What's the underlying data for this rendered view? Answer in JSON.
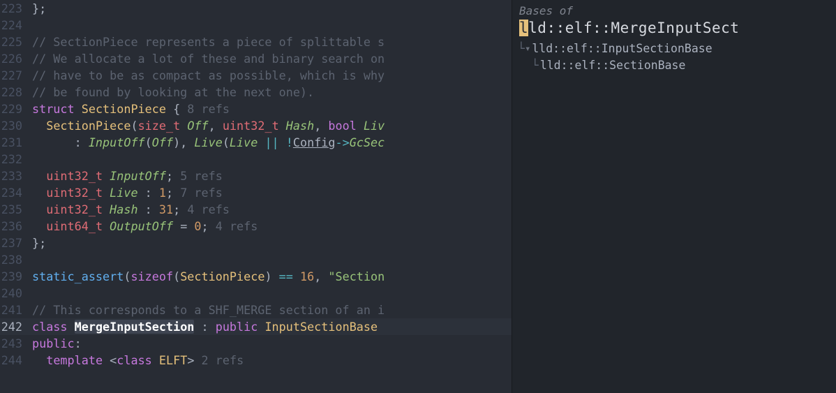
{
  "editor": {
    "lines": [
      {
        "num": "223",
        "tokens": [
          {
            "t": "};",
            "c": "punct"
          }
        ]
      },
      {
        "num": "224",
        "tokens": []
      },
      {
        "num": "225",
        "tokens": [
          {
            "t": "// SectionPiece represents a piece of splittable s",
            "c": "comment"
          }
        ]
      },
      {
        "num": "226",
        "tokens": [
          {
            "t": "// We allocate a lot of these and binary search on",
            "c": "comment"
          }
        ]
      },
      {
        "num": "227",
        "tokens": [
          {
            "t": "// have to be as compact as possible, which is why",
            "c": "comment"
          }
        ]
      },
      {
        "num": "228",
        "tokens": [
          {
            "t": "// be found by looking at the next one).",
            "c": "comment"
          }
        ]
      },
      {
        "num": "229",
        "tokens": [
          {
            "t": "struct",
            "c": "keyword"
          },
          {
            "t": " "
          },
          {
            "t": "SectionPiece",
            "c": "typename"
          },
          {
            "t": " { ",
            "c": "punct"
          },
          {
            "t": "8 refs",
            "c": "hint"
          }
        ]
      },
      {
        "num": "230",
        "tokens": [
          {
            "t": "  "
          },
          {
            "t": "SectionPiece",
            "c": "typename"
          },
          {
            "t": "(",
            "c": "punct"
          },
          {
            "t": "size_t",
            "c": "type"
          },
          {
            "t": " "
          },
          {
            "t": "Off",
            "c": "param"
          },
          {
            "t": ", ",
            "c": "punct"
          },
          {
            "t": "uint32_t",
            "c": "type"
          },
          {
            "t": " "
          },
          {
            "t": "Hash",
            "c": "param"
          },
          {
            "t": ", ",
            "c": "punct"
          },
          {
            "t": "bool",
            "c": "keyword"
          },
          {
            "t": " "
          },
          {
            "t": "Liv",
            "c": "param"
          }
        ]
      },
      {
        "num": "231",
        "tokens": [
          {
            "t": "      : ",
            "c": "punct"
          },
          {
            "t": "InputOff",
            "c": "param italic"
          },
          {
            "t": "(",
            "c": "punct"
          },
          {
            "t": "Off",
            "c": "param"
          },
          {
            "t": "), ",
            "c": "punct"
          },
          {
            "t": "Live",
            "c": "param italic"
          },
          {
            "t": "(",
            "c": "punct"
          },
          {
            "t": "Live",
            "c": "param"
          },
          {
            "t": " ",
            "c": "punct"
          },
          {
            "t": "||",
            "c": "op"
          },
          {
            "t": " ",
            "c": "punct"
          },
          {
            "t": "!",
            "c": "op"
          },
          {
            "t": "Config",
            "c": "ident underline"
          },
          {
            "t": "->",
            "c": "op"
          },
          {
            "t": "GcSec",
            "c": "param italic"
          }
        ]
      },
      {
        "num": "232",
        "tokens": []
      },
      {
        "num": "233",
        "tokens": [
          {
            "t": "  "
          },
          {
            "t": "uint32_t",
            "c": "type"
          },
          {
            "t": " "
          },
          {
            "t": "InputOff",
            "c": "param italic"
          },
          {
            "t": "; ",
            "c": "punct"
          },
          {
            "t": "5 refs",
            "c": "hint"
          }
        ]
      },
      {
        "num": "234",
        "tokens": [
          {
            "t": "  "
          },
          {
            "t": "uint32_t",
            "c": "type"
          },
          {
            "t": " "
          },
          {
            "t": "Live",
            "c": "param italic"
          },
          {
            "t": " : ",
            "c": "punct"
          },
          {
            "t": "1",
            "c": "num"
          },
          {
            "t": "; ",
            "c": "punct"
          },
          {
            "t": "7 refs",
            "c": "hint"
          }
        ]
      },
      {
        "num": "235",
        "tokens": [
          {
            "t": "  "
          },
          {
            "t": "uint32_t",
            "c": "type"
          },
          {
            "t": " "
          },
          {
            "t": "Hash",
            "c": "param italic"
          },
          {
            "t": " : ",
            "c": "punct"
          },
          {
            "t": "31",
            "c": "num"
          },
          {
            "t": "; ",
            "c": "punct"
          },
          {
            "t": "4 refs",
            "c": "hint"
          }
        ]
      },
      {
        "num": "236",
        "tokens": [
          {
            "t": "  "
          },
          {
            "t": "uint64_t",
            "c": "type"
          },
          {
            "t": " "
          },
          {
            "t": "OutputOff",
            "c": "param italic"
          },
          {
            "t": " = ",
            "c": "punct"
          },
          {
            "t": "0",
            "c": "num"
          },
          {
            "t": "; ",
            "c": "punct"
          },
          {
            "t": "4 refs",
            "c": "hint"
          }
        ]
      },
      {
        "num": "237",
        "tokens": [
          {
            "t": "};",
            "c": "punct"
          }
        ]
      },
      {
        "num": "238",
        "tokens": []
      },
      {
        "num": "239",
        "tokens": [
          {
            "t": "static_assert",
            "c": "func"
          },
          {
            "t": "(",
            "c": "punct"
          },
          {
            "t": "sizeof",
            "c": "keyword"
          },
          {
            "t": "(",
            "c": "punct"
          },
          {
            "t": "SectionPiece",
            "c": "typename"
          },
          {
            "t": ") ",
            "c": "punct"
          },
          {
            "t": "==",
            "c": "op"
          },
          {
            "t": " ",
            "c": "punct"
          },
          {
            "t": "16",
            "c": "num"
          },
          {
            "t": ", ",
            "c": "punct"
          },
          {
            "t": "\"Section",
            "c": "str"
          }
        ]
      },
      {
        "num": "240",
        "tokens": []
      },
      {
        "num": "241",
        "tokens": [
          {
            "t": "// This corresponds to a SHF_MERGE section of an i",
            "c": "comment"
          }
        ]
      },
      {
        "num": "242",
        "current": true,
        "tokens": [
          {
            "t": "class",
            "c": "keyword"
          },
          {
            "t": " "
          },
          {
            "t": "MergeInputSection",
            "c": "sel"
          },
          {
            "t": " : ",
            "c": "punct"
          },
          {
            "t": "public",
            "c": "keyword"
          },
          {
            "t": " "
          },
          {
            "t": "InputSectionBase",
            "c": "typename"
          },
          {
            "t": " ",
            "c": "punct"
          }
        ]
      },
      {
        "num": "243",
        "tokens": [
          {
            "t": "public",
            "c": "keyword"
          },
          {
            "t": ":",
            "c": "punct"
          }
        ]
      },
      {
        "num": "244",
        "tokens": [
          {
            "t": "  "
          },
          {
            "t": "template",
            "c": "keyword"
          },
          {
            "t": " <",
            "c": "punct"
          },
          {
            "t": "class",
            "c": "keyword"
          },
          {
            "t": " "
          },
          {
            "t": "ELFT",
            "c": "typename"
          },
          {
            "t": "> ",
            "c": "punct"
          },
          {
            "t": "2 refs",
            "c": "hint"
          }
        ]
      }
    ]
  },
  "panel": {
    "title": "Bases of",
    "main_cursor_char": "l",
    "main_rest": "ld::elf::MergeInputSect",
    "tree": [
      {
        "prefix": "└",
        "arrow": "▾",
        "text": "lld::elf::InputSectionBase"
      },
      {
        "prefix": "  └",
        "arrow": "",
        "text": "lld::elf::SectionBase"
      }
    ]
  }
}
